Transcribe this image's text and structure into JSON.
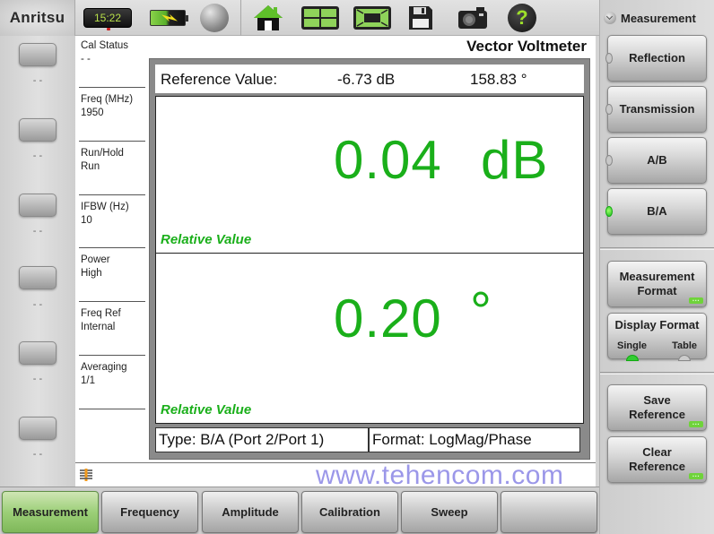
{
  "topbar": {
    "logo": "Anritsu",
    "clock": "15:22",
    "icons": [
      "battery-charging-icon",
      "globe-icon",
      "home-icon",
      "layout-grid-icon",
      "fullscreen-icon",
      "save-disk-icon",
      "camera-icon",
      "help-icon"
    ]
  },
  "left_softkeys": [
    {
      "label": "- -"
    },
    {
      "label": "- -"
    },
    {
      "label": "- -"
    },
    {
      "label": "- -"
    },
    {
      "label": "- -"
    },
    {
      "label": "- -"
    }
  ],
  "status": [
    {
      "title": "Cal Status",
      "value": "- -"
    },
    {
      "title": "Freq (MHz)",
      "value": "1950"
    },
    {
      "title": "Run/Hold",
      "value": "Run"
    },
    {
      "title": "IFBW (Hz)",
      "value": "10"
    },
    {
      "title": "Power",
      "value": "High"
    },
    {
      "title": "Freq Ref",
      "value": "Internal"
    },
    {
      "title": "Averaging",
      "value": "1/1"
    }
  ],
  "main": {
    "title": "Vector Voltmeter",
    "reference": {
      "label": "Reference Value:",
      "magnitude": "-6.73 dB",
      "phase": "158.83 °"
    },
    "magnitude": {
      "value": "0.04",
      "unit": "dB",
      "label": "Relative Value"
    },
    "phase": {
      "value": "0.20",
      "unit": "°",
      "label": "Relative Value"
    },
    "type": "Type: B/A (Port 2/Port 1)",
    "format": "Format: LogMag/Phase"
  },
  "watermark": "www.tehencom.com",
  "right_menu": {
    "title": "Measurement",
    "options": [
      {
        "label": "Reflection",
        "selected": false
      },
      {
        "label": "Transmission",
        "selected": false
      },
      {
        "label": "A/B",
        "selected": false
      },
      {
        "label": "B/A",
        "selected": true
      }
    ],
    "measurement_format": {
      "line1": "Measurement",
      "line2": "Format"
    },
    "display_format": {
      "label": "Display Format",
      "options": [
        "Single",
        "Table"
      ],
      "selected": "Single"
    },
    "save_reference": {
      "line1": "Save",
      "line2": "Reference"
    },
    "clear_reference": {
      "line1": "Clear",
      "line2": "Reference"
    }
  },
  "bottom_tabs": [
    {
      "label": "Measurement",
      "active": true
    },
    {
      "label": "Frequency",
      "active": false
    },
    {
      "label": "Amplitude",
      "active": false
    },
    {
      "label": "Calibration",
      "active": false
    },
    {
      "label": "Sweep",
      "active": false
    },
    {
      "label": "",
      "active": false
    }
  ],
  "colors": {
    "value_green": "#1aaf1a",
    "active_tab": "#9ccf78",
    "led_on": "#22bb22",
    "watermark": "#8a86e6"
  }
}
